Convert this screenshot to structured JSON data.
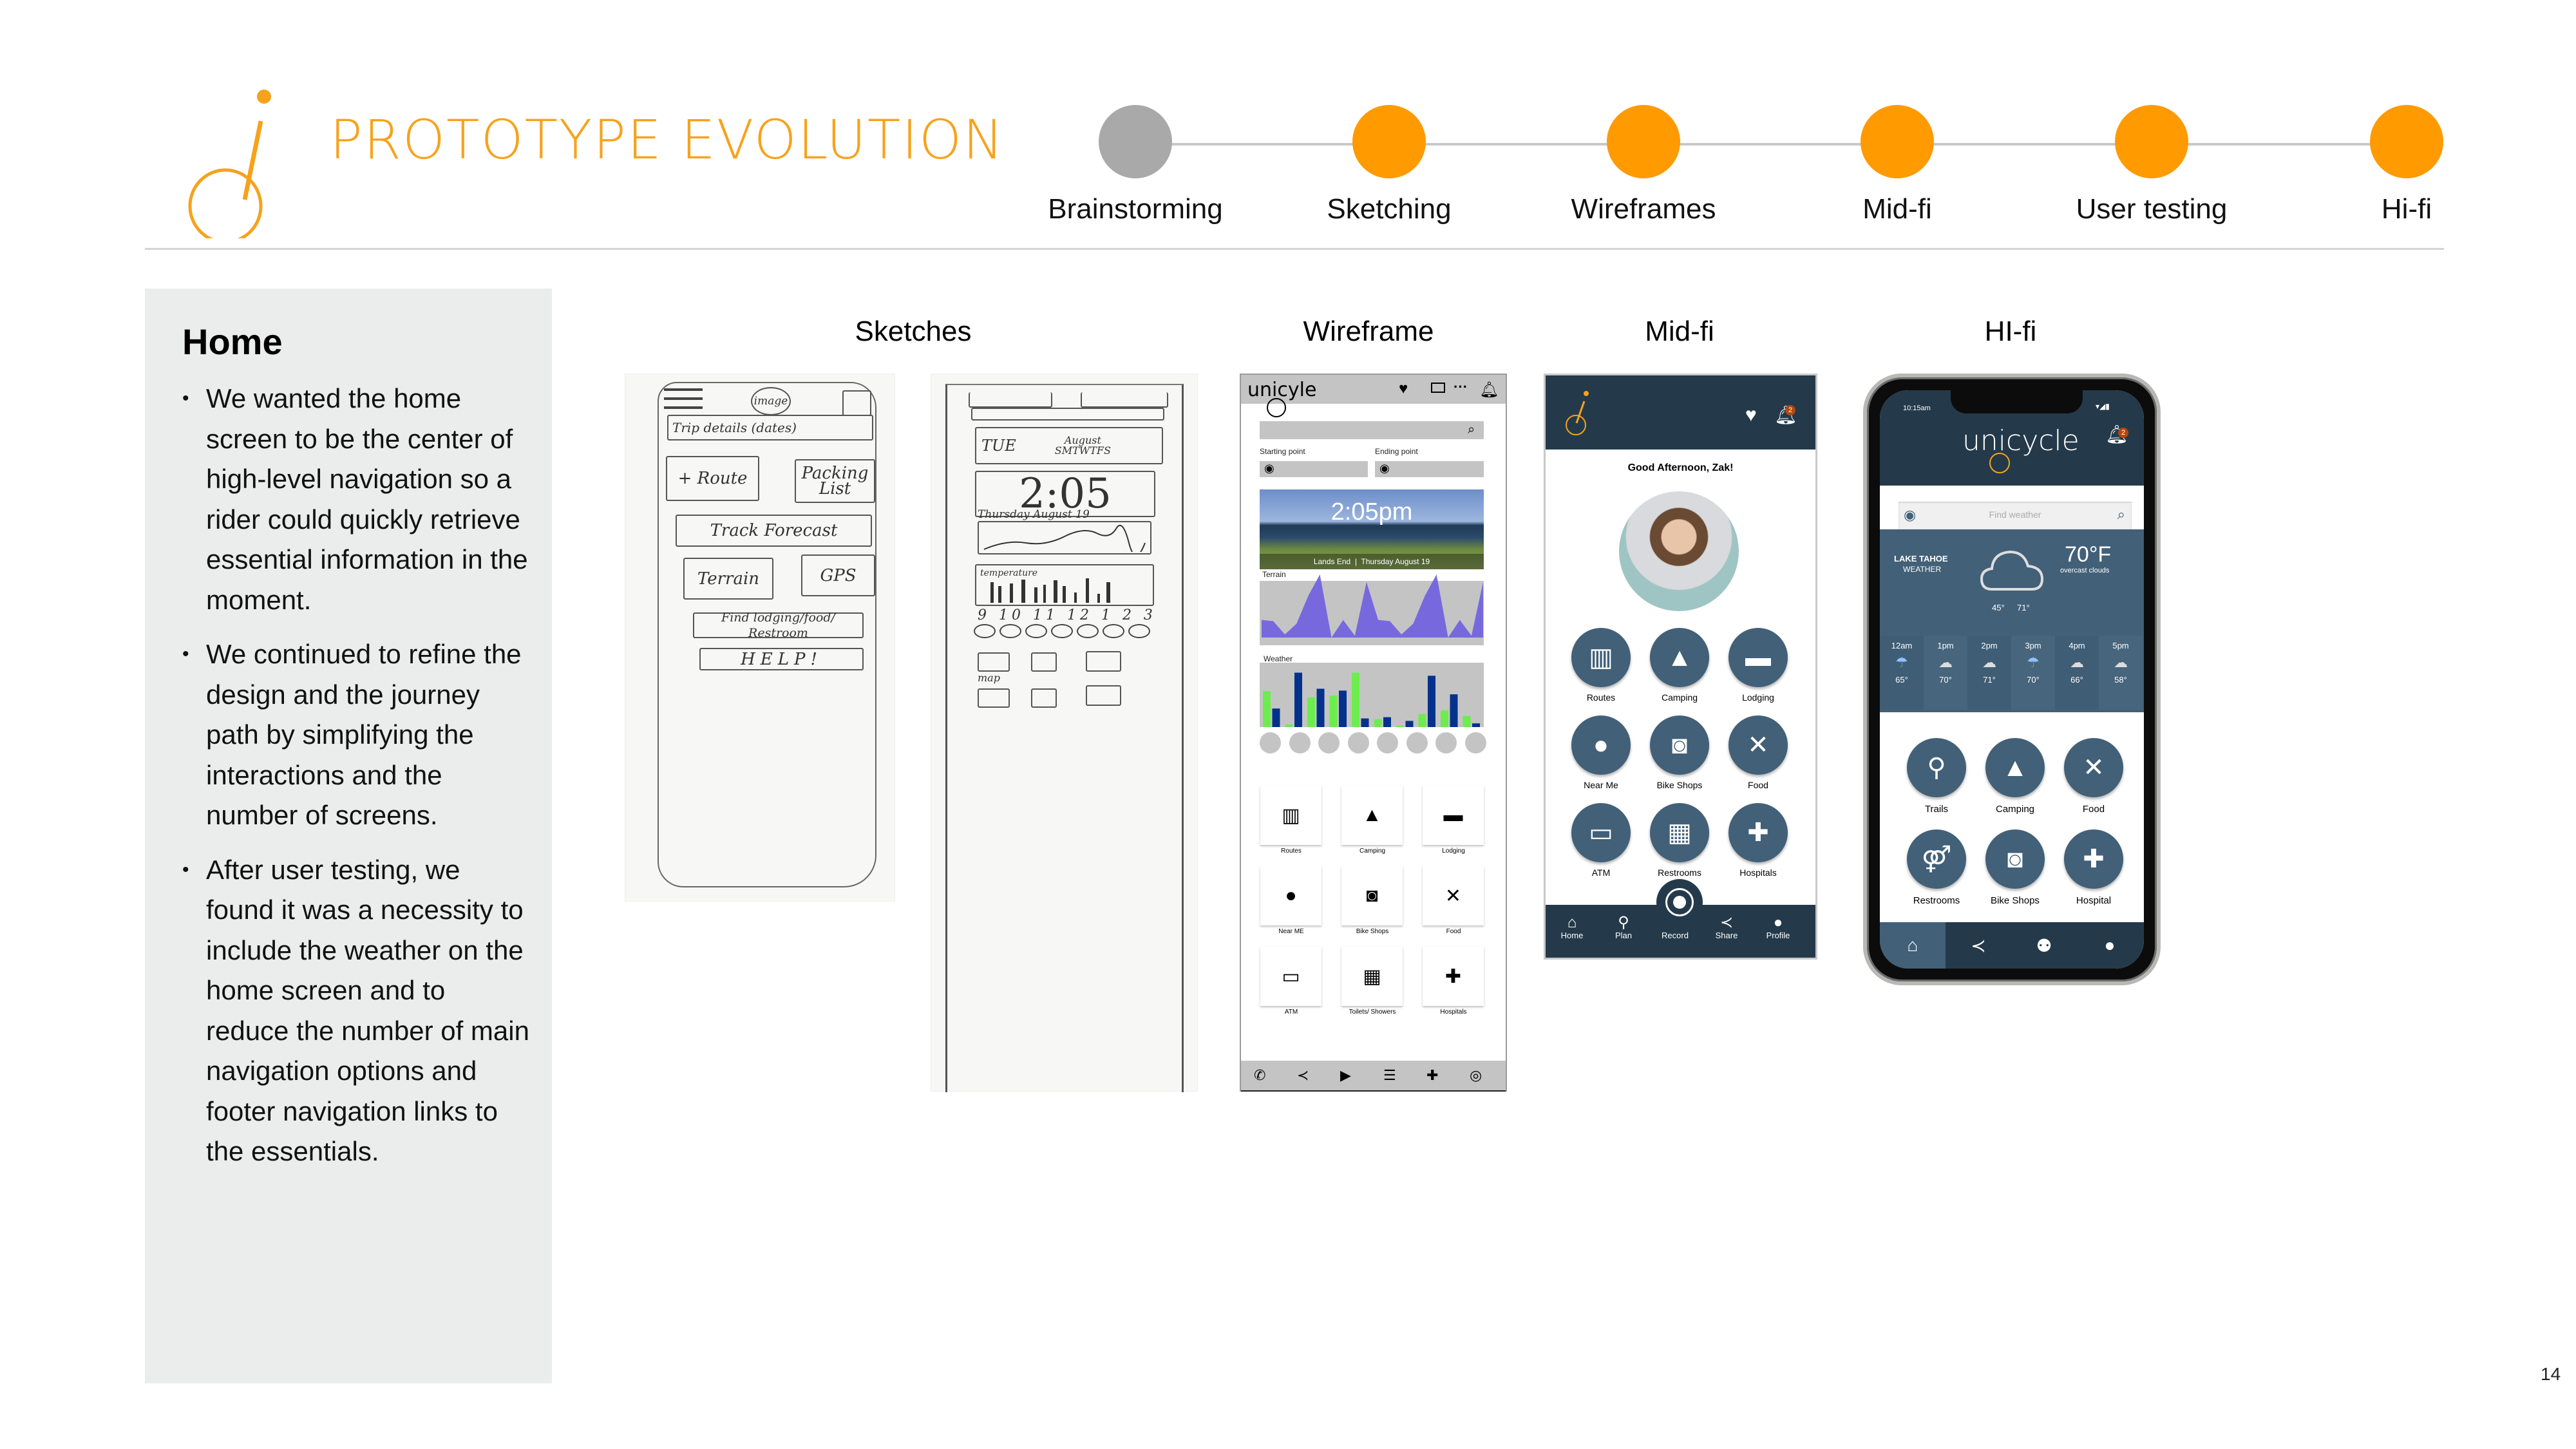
{
  "header": {
    "title": "PROTOTYPE EVOLUTION",
    "brand_color": "#f7a21b",
    "timeline": [
      {
        "label": "Brainstorming",
        "state": "inactive",
        "color": "#a9a9a9"
      },
      {
        "label": "Sketching",
        "state": "active",
        "color": "#ff9a00"
      },
      {
        "label": "Wireframes",
        "state": "active",
        "color": "#ff9a00"
      },
      {
        "label": "Mid-fi",
        "state": "active",
        "color": "#ff9a00"
      },
      {
        "label": "User testing",
        "state": "active",
        "color": "#ff9a00"
      },
      {
        "label": "Hi-fi",
        "state": "active",
        "color": "#ff9a00"
      }
    ]
  },
  "panel": {
    "title": "Home",
    "bullets": [
      "We wanted the home screen to be the center of high-level navigation so a rider could quickly retrieve essential information in the moment.",
      "We continued to refine the design and the journey path by simplifying the interactions and the number of screens.",
      "After user testing, we found it was a necessity to include the weather on the home screen and to reduce the number of main navigation options and footer navigation links to the essentials."
    ]
  },
  "columns": {
    "sketches": "Sketches",
    "wireframe": "Wireframe",
    "midfi": "Mid-fi",
    "hifi": "HI-fi"
  },
  "sketch1": {
    "image_label": "image",
    "boxes": [
      "Trip details (dates)",
      "+ Route",
      "Packing List",
      "Track Forecast",
      "Terrain",
      "GPS",
      "Find lodging/food/ Restroom",
      "HELP!"
    ]
  },
  "sketch2": {
    "calendar_day": "TUE",
    "calendar_month": "August",
    "calendar_weekdays": "SMTWTFS",
    "time": "2:05",
    "date": "Thursday August 19",
    "chart_label": "temperature",
    "hours": "9 10 11 12 1 2 3",
    "tile_label": "map"
  },
  "wireframe": {
    "logo": "unicyle",
    "start_label": "Starting point",
    "end_label": "Ending point",
    "time": "2:05pm",
    "location_date": "Lands End  |  Thursday August 19",
    "terrain_label": "Terrain",
    "weather_label": "Weather",
    "weather_bars": {
      "green": [
        0.58,
        0.04,
        0.48,
        0.51,
        0.88,
        0.13,
        0.02,
        0.21,
        0.27,
        0.18
      ],
      "navy": [
        0.3,
        0.88,
        0.62,
        0.59,
        0.14,
        0.16,
        0.1,
        0.83,
        0.53,
        0.06
      ]
    },
    "terrain_points": [
      0.28,
      0.26,
      0.05,
      0.22,
      0.66,
      1.0,
      0.0,
      0.28,
      0.03,
      0.88,
      0.28,
      0.26,
      0.05,
      0.22,
      0.66,
      1.0,
      0.0,
      0.28,
      0.03,
      0.88
    ],
    "tiles": [
      {
        "label": "Routes",
        "icon": "map-icon"
      },
      {
        "label": "Camping",
        "icon": "tent-icon"
      },
      {
        "label": "Lodging",
        "icon": "bed-icon"
      },
      {
        "label": "Near ME",
        "icon": "location-pin-icon"
      },
      {
        "label": "Bike Shops",
        "icon": "bike-bag-icon"
      },
      {
        "label": "Food",
        "icon": "utensils-icon"
      },
      {
        "label": "ATM",
        "icon": "atm-icon"
      },
      {
        "label": "Toilets/ Showers",
        "icon": "toilet-icon"
      },
      {
        "label": "Hospitals",
        "icon": "hospital-icon"
      }
    ],
    "footer_icons": [
      "phone-icon",
      "share-icon",
      "video-chat-icon",
      "message-icon",
      "hospital-icon",
      "gps-icon"
    ]
  },
  "midfi": {
    "greeting": "Good Afternoon, Zak!",
    "notification_count": "2",
    "tiles": [
      {
        "label": "Routes",
        "icon": "map-icon"
      },
      {
        "label": "Camping",
        "icon": "tent-icon"
      },
      {
        "label": "Lodging",
        "icon": "bed-icon"
      },
      {
        "label": "Near Me",
        "icon": "location-pin-icon"
      },
      {
        "label": "Bike Shops",
        "icon": "bike-bag-icon"
      },
      {
        "label": "Food",
        "icon": "utensils-icon"
      },
      {
        "label": "ATM",
        "icon": "atm-icon"
      },
      {
        "label": "Restrooms",
        "icon": "toilet-icon"
      },
      {
        "label": "Hospitals",
        "icon": "hospital-icon"
      }
    ],
    "nav": [
      "Home",
      "Plan",
      "Record",
      "Share",
      "Profile"
    ]
  },
  "hifi": {
    "status_time": "10:15am",
    "logo": "unicycle",
    "notification_count": "2",
    "search_placeholder": "Find weather",
    "weather": {
      "location": "LAKE TAHOE",
      "sublabel": "WEATHER",
      "temp": "70°F",
      "condition": "overcast clouds",
      "low": "45°",
      "high": "71°",
      "hourly": [
        {
          "time": "12am",
          "icon": "rain-cloud-icon",
          "temp": "65°"
        },
        {
          "time": "1pm",
          "icon": "cloud-icon",
          "temp": "70°"
        },
        {
          "time": "2pm",
          "icon": "cloud-icon",
          "temp": "71°"
        },
        {
          "time": "3pm",
          "icon": "rain-cloud-icon",
          "temp": "70°"
        },
        {
          "time": "4pm",
          "icon": "cloud-icon",
          "temp": "66°"
        },
        {
          "time": "5pm",
          "icon": "cloud-icon",
          "temp": "58°"
        }
      ]
    },
    "tiles": [
      {
        "label": "Trails",
        "icon": "cyclist-icon"
      },
      {
        "label": "Camping",
        "icon": "tent-icon"
      },
      {
        "label": "Food",
        "icon": "utensils-icon"
      },
      {
        "label": "Restrooms",
        "icon": "restroom-icon"
      },
      {
        "label": "Bike Shops",
        "icon": "bike-bag-icon"
      },
      {
        "label": "Hospital",
        "icon": "hospital-icon"
      }
    ],
    "nav_icons": [
      "home-icon",
      "share-icon",
      "group-icon",
      "profile-icon"
    ]
  },
  "page_number": "14"
}
